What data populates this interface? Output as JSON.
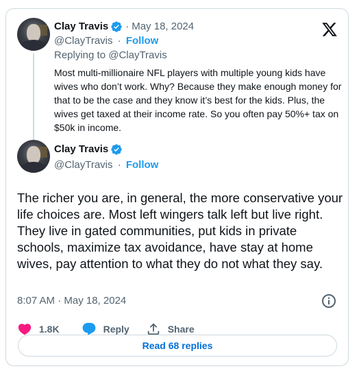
{
  "quoted_tweet": {
    "author_name": "Clay Travis",
    "handle": "@ClayTravis",
    "date": "May 18, 2024",
    "follow_label": "Follow",
    "replying_to_prefix": "Replying to ",
    "replying_to_handle": "@ClayTravis",
    "text": "Most multi-millionaire NFL players with multiple young kids have wives who don’t work. Why? Because they make enough money for that to be the case and they know it’s best for the kids. Plus, the wives get taxed at their income rate. So you often pay 50%+ tax on $50k in income."
  },
  "main_tweet": {
    "author_name": "Clay Travis",
    "handle": "@ClayTravis",
    "follow_label": "Follow",
    "text": "The richer you are, in general, the more conservative your life choices are. Most left wingers talk left but live right. They live in gated communities, put kids in private schools, maximize tax avoidance, have stay at home wives, pay attention to what they do not what they say.",
    "timestamp": "8:07 AM · May 18, 2024"
  },
  "actions": {
    "like_count": "1.8K",
    "reply_label": "Reply",
    "share_label": "Share"
  },
  "read_replies_label": "Read 68 replies",
  "separator": "·",
  "colors": {
    "accent": "#1d9bf0",
    "like": "#f91880",
    "muted": "#536471",
    "border": "#cfd9de"
  },
  "icons": [
    "x-logo-icon",
    "verified-badge-icon",
    "info-icon",
    "heart-icon",
    "reply-bubble-icon",
    "share-icon"
  ]
}
